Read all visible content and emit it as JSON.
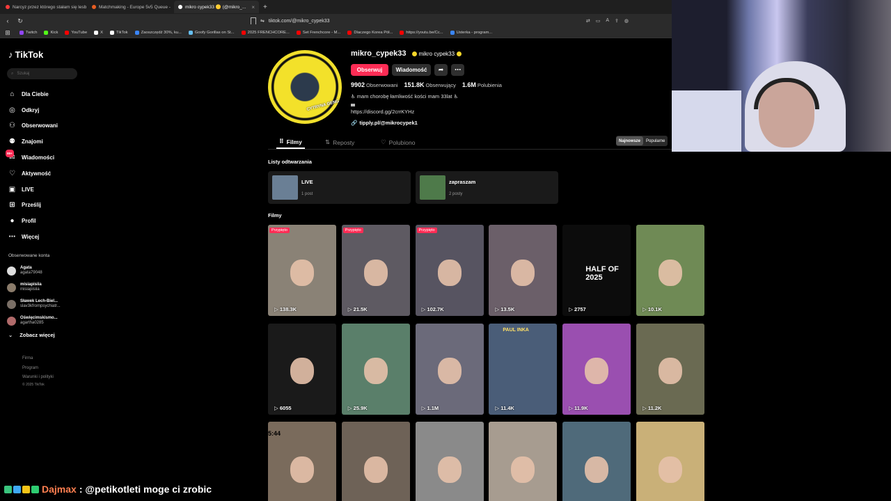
{
  "browser": {
    "tabs": [
      {
        "title": "Narcyz przez którego stałam się lesb",
        "color": "#ff3b3b",
        "active": false
      },
      {
        "title": "Matchmaking - Europe 5v5 Queue -",
        "color": "#e85d22",
        "active": false
      },
      {
        "title": "mikro cypek33 🟡 (@mikro_...",
        "color": "#ffffff",
        "active": true
      }
    ],
    "url": "tiktok.com/@mikro_cypek33",
    "bookmarks": [
      {
        "label": "Twitch",
        "color": "#9146ff"
      },
      {
        "label": "Kick",
        "color": "#53fc18"
      },
      {
        "label": "YouTube",
        "color": "#ff0000"
      },
      {
        "label": "X",
        "color": "#ffffff"
      },
      {
        "label": "TikTok",
        "color": "#ffffff"
      },
      {
        "label": "Zaoszczędź 30%, ku...",
        "color": "#3a86ff"
      },
      {
        "label": "Goofy Gorillas on St...",
        "color": "#66c0f4"
      },
      {
        "label": "2025 FRENCHCORE...",
        "color": "#ff0000"
      },
      {
        "label": "Set Frenchcore - M...",
        "color": "#ff0000"
      },
      {
        "label": "Dlaczego Korea Pół...",
        "color": "#ff0000"
      },
      {
        "label": "https://youtu.be/Cc...",
        "color": "#ff0000"
      },
      {
        "label": "Usterka - program...",
        "color": "#3a86ff"
      }
    ]
  },
  "sidebar": {
    "logo": "TikTok",
    "search_placeholder": "Szukaj",
    "nav": [
      {
        "label": "Dla Ciebie",
        "icon": "home-icon",
        "glyph": "⌂"
      },
      {
        "label": "Odkryj",
        "icon": "compass-icon",
        "glyph": "◎"
      },
      {
        "label": "Obserwowani",
        "icon": "following-icon",
        "glyph": "⚇"
      },
      {
        "label": "Znajomi",
        "icon": "friends-icon",
        "glyph": "⚉"
      },
      {
        "label": "Wiadomości",
        "icon": "messages-icon",
        "glyph": "✉",
        "badge": "99+"
      },
      {
        "label": "Aktywność",
        "icon": "activity-icon",
        "glyph": "♡"
      },
      {
        "label": "LIVE",
        "icon": "live-icon",
        "glyph": "▣"
      },
      {
        "label": "Prześlij",
        "icon": "upload-icon",
        "glyph": "⊞"
      },
      {
        "label": "Profil",
        "icon": "profile-icon",
        "glyph": "●"
      },
      {
        "label": "Więcej",
        "icon": "more-icon",
        "glyph": "⋯"
      }
    ],
    "following_title": "Obserwowane konta",
    "following": [
      {
        "name": "Agata",
        "handle": "agata79048",
        "color": "#ddd"
      },
      {
        "name": "misiapisiia",
        "handle": "misiapisiia",
        "color": "#8a7b6a"
      },
      {
        "name": "Sławek Lech-Biel...",
        "handle": "slav3kfrompsychiatr...",
        "color": "#7a6f66"
      },
      {
        "name": "Oświęcimskismo...",
        "handle": "agartha0285",
        "color": "#b06a6a"
      }
    ],
    "see_more": "Zobacz więcej",
    "footer": [
      "Firma",
      "Program",
      "Warunki i polityki"
    ],
    "copyright": "© 2025 TikTok"
  },
  "profile": {
    "username": "mikro_cypek33",
    "display_name": "mikro cypek33",
    "avatar_text": "CYTRYNA GENG",
    "follow_label": "Obserwuj",
    "message_label": "Wiadomość",
    "stats": [
      {
        "value": "9902",
        "label": "Obserwowani"
      },
      {
        "value": "151.8K",
        "label": "Obserwujący"
      },
      {
        "value": "1.6M",
        "label": "Polubienia"
      }
    ],
    "bio_line": "♿ mam chorobę łamliwość kości mam 33lat ♿",
    "bio_link_text": "https://discord.gg/2crrKYHz",
    "link": "tipply.pl/@mikrocypek1"
  },
  "tabs": [
    {
      "label": "Filmy",
      "icon": "grid-icon",
      "glyph": "⠿",
      "active": true
    },
    {
      "label": "Reposty",
      "icon": "repost-icon",
      "glyph": "⇅",
      "active": false
    },
    {
      "label": "Polubiono",
      "icon": "liked-icon",
      "glyph": "♡",
      "active": false
    }
  ],
  "sort": {
    "newest": "Najnowsze",
    "popular": "Popularne"
  },
  "playlists_title": "Listy odtwarzania",
  "playlists": [
    {
      "name": "LIVE",
      "count": "1 post",
      "color": "#6a7f95"
    },
    {
      "name": "zapraszam",
      "count": "2 posty",
      "color": "#4e7a4a"
    }
  ],
  "videos_title": "Filmy",
  "pinned_label": "Przypięto",
  "videos": [
    {
      "count": "138.3K",
      "pinned": true,
      "bg": "#8a8276"
    },
    {
      "count": "21.5K",
      "pinned": true,
      "bg": "#5e5a62"
    },
    {
      "count": "102.7K",
      "pinned": true,
      "bg": "#575461"
    },
    {
      "count": "13.5K",
      "pinned": false,
      "bg": "#6b5f69"
    },
    {
      "count": "2757",
      "pinned": false,
      "bg": "#0c0c0c",
      "overlay": "HALF OF 2025"
    },
    {
      "count": "10.1K",
      "pinned": false,
      "bg": "#6f8a55"
    },
    {
      "count": "6055",
      "pinned": false,
      "bg": "#1a1a1a"
    },
    {
      "count": "25.9K",
      "pinned": false,
      "bg": "#5a7f6a"
    },
    {
      "count": "1.1M",
      "pinned": false,
      "bg": "#6b6a7a"
    },
    {
      "count": "11.4K",
      "pinned": false,
      "bg": "#4a5d78",
      "overlay": "PAUL INKA"
    },
    {
      "count": "11.9K",
      "pinned": false,
      "bg": "#9a4fb0"
    },
    {
      "count": "11.2K",
      "pinned": false,
      "bg": "#6a6a52"
    },
    {
      "count": "",
      "pinned": false,
      "bg": "#7a6b5c",
      "overlay": "5:44"
    },
    {
      "count": "",
      "pinned": false,
      "bg": "#6e6257"
    },
    {
      "count": "",
      "pinned": false,
      "bg": "#8a8a8a"
    },
    {
      "count": "",
      "pinned": false,
      "bg": "#a79c90"
    },
    {
      "count": "",
      "pinned": false,
      "bg": "#4f6a7a"
    },
    {
      "count": "",
      "pinned": false,
      "bg": "#c9b078"
    }
  ],
  "chat": {
    "user": "Dajmax",
    "message": ": @petikotleti moge ci zrobic",
    "badge_colors": [
      "#3ac47d",
      "#3fa9f5",
      "#f5c518",
      "#2ecc71"
    ]
  }
}
